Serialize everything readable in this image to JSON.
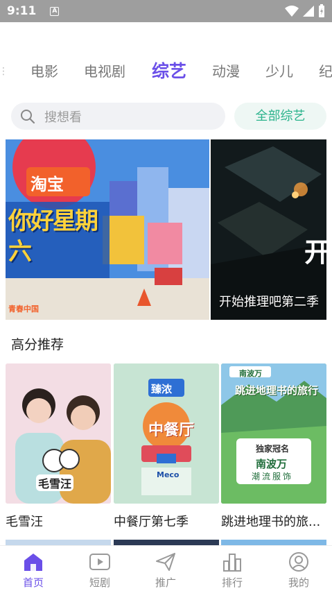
{
  "status": {
    "time": "9:11",
    "notif_letter": "A"
  },
  "categories": [
    "电影",
    "电视剧",
    "综艺",
    "动漫",
    "少儿",
    "纪"
  ],
  "active_category": "综艺",
  "search": {
    "placeholder": "搜想看",
    "all_button": "全部综艺"
  },
  "banners": {
    "main": {
      "logo_text": "淘宝",
      "title_art": "你好星期六",
      "corner_text": "青春中国"
    },
    "side": {
      "caption": "开始推理吧第二季",
      "peek_char": "开"
    }
  },
  "section": {
    "title": "高分推荐"
  },
  "cards": [
    {
      "title": "毛雪汪",
      "poster_text": "毛雪汪"
    },
    {
      "title": "中餐厅第七季",
      "poster_text": "中餐厅",
      "brand": "臻浓",
      "sub_brand": "Meco"
    },
    {
      "title": "跳进地理书的旅...",
      "poster_text": "跳进地理书的旅行",
      "sponsor": "南波万",
      "sponsor_line1": "独家冠名",
      "sponsor_line2": "潮流服饰"
    }
  ],
  "bottom_nav": [
    {
      "label": "首页",
      "icon": "home-icon",
      "active": true
    },
    {
      "label": "短剧",
      "icon": "play-icon",
      "active": false
    },
    {
      "label": "推广",
      "icon": "send-icon",
      "active": false
    },
    {
      "label": "排行",
      "icon": "chart-icon",
      "active": false
    },
    {
      "label": "我的",
      "icon": "user-icon",
      "active": false
    }
  ],
  "colors": {
    "accent": "#6a4fe8",
    "green": "#2bb38c",
    "status_bar": "#9e9e9e"
  }
}
